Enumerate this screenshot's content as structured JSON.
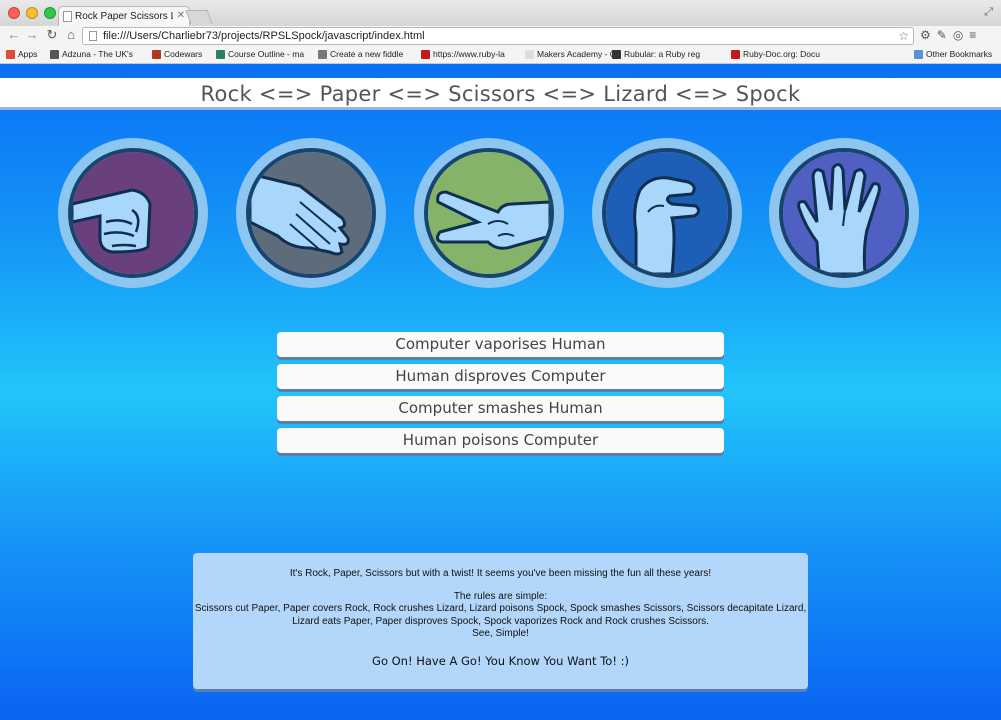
{
  "browser": {
    "tab_title": "Rock Paper Scissors Lizard",
    "url": "file:///Users/Charliebr73/projects/RPSLSpock/javascript/index.html"
  },
  "bookmarks": [
    {
      "label": "Apps",
      "icon": "apps-grid-icon",
      "color": "#e04a3a"
    },
    {
      "label": "Adzuna - The UK's",
      "icon": "search-icon",
      "color": "#555555"
    },
    {
      "label": "Codewars",
      "icon": "codewars-icon",
      "color": "#b1361e"
    },
    {
      "label": "Course Outline - ma",
      "icon": "h-icon",
      "color": "#2a7f62"
    },
    {
      "label": "Create a new fiddle",
      "icon": "cloud-icon",
      "color": "#777777"
    },
    {
      "label": "https://www.ruby-la",
      "icon": "ruby-icon",
      "color": "#c21a1a"
    },
    {
      "label": "Makers Academy - C",
      "icon": "page-icon",
      "color": "#dddddd"
    },
    {
      "label": "Rubular: a Ruby reg",
      "icon": "r-icon",
      "color": "#333333"
    },
    {
      "label": "Ruby-Doc.org: Docu",
      "icon": "ruby-icon",
      "color": "#c21a1a"
    },
    {
      "label": "Other Bookmarks",
      "icon": "folder-icon",
      "color": "#5b8fd6"
    }
  ],
  "page": {
    "title": "Rock <=> Paper <=> Scissors <=> Lizard <=> Spock",
    "choices": [
      {
        "name": "Rock",
        "icon": "fist-icon",
        "color": "#6a3f7d"
      },
      {
        "name": "Paper",
        "icon": "open-hand-icon",
        "color": "#5d6b7b"
      },
      {
        "name": "Scissors",
        "icon": "scissors-hand-icon",
        "color": "#86b36a"
      },
      {
        "name": "Lizard",
        "icon": "lizard-hand-icon",
        "color": "#1d5fb6"
      },
      {
        "name": "Spock",
        "icon": "spock-hand-icon",
        "color": "#4f5fc2"
      }
    ],
    "results": [
      "Computer vaporises Human",
      "Human disproves Computer",
      "Computer smashes Human",
      "Human poisons Computer"
    ],
    "rules": {
      "intro": "It's Rock, Paper, Scissors but with a twist! It seems you've been missing the fun all these years!",
      "heading": "The rules are simple:",
      "body": "Scissors cut Paper, Paper covers Rock, Rock crushes Lizard, Lizard poisons Spock, Spock smashes Scissors, Scissors decapitate Lizard, Lizard eats Paper, Paper disproves Spock, Spock vaporizes Rock and Rock crushes Scissors.",
      "closing": "See, Simple!",
      "cta": "Go On! Have A Go! You Know You Want To! :)"
    }
  }
}
